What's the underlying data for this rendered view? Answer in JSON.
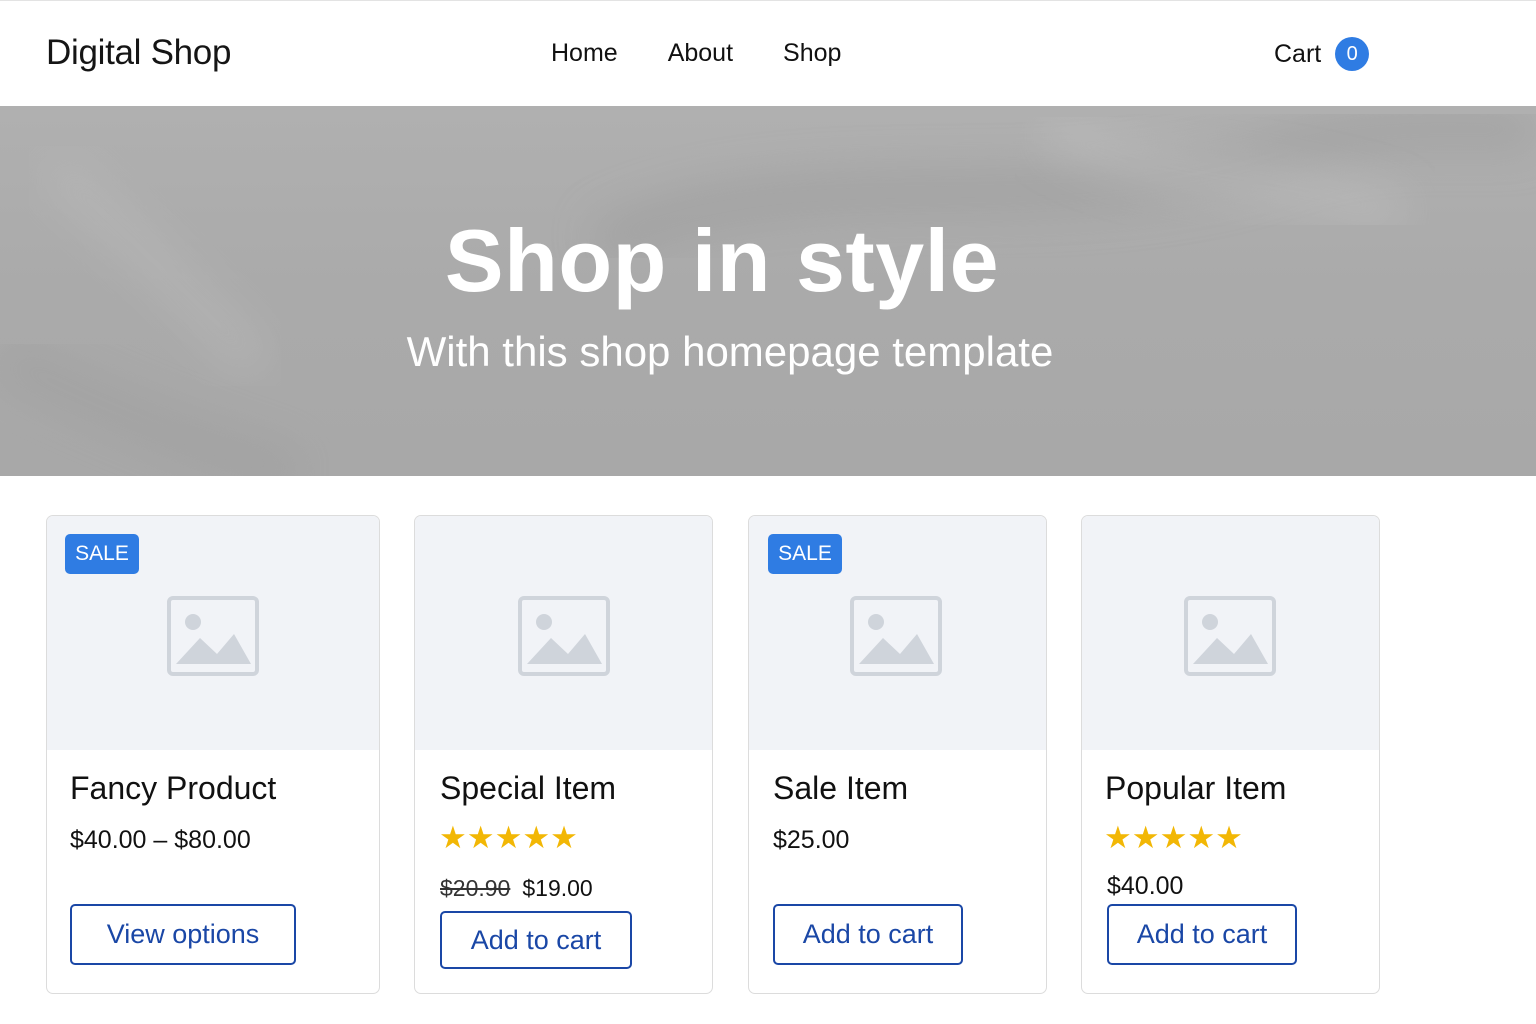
{
  "nav": {
    "brand": "Digital Shop",
    "links": [
      "Home",
      "About",
      "Shop"
    ],
    "cart_label": "Cart",
    "cart_count": "0"
  },
  "hero": {
    "title": "Shop in style",
    "subtitle": "With this shop homepage template"
  },
  "products": [
    {
      "badge": "SALE",
      "title": "Fancy Product",
      "price": "$40.00 – $80.00",
      "button": "View options",
      "image_icon": "image-placeholder-icon"
    },
    {
      "title": "Special Item",
      "rating": 5,
      "stars": "★★★★★",
      "old_price": "$20.90",
      "price": "$19.00",
      "button": "Add to cart",
      "image_icon": "image-placeholder-icon"
    },
    {
      "badge": "SALE",
      "title": "Sale Item",
      "price": "$25.00",
      "button": "Add to cart",
      "image_icon": "image-placeholder-icon"
    },
    {
      "title": "Popular Item",
      "rating": 5,
      "stars": "★★★★★",
      "price": "$40.00",
      "button": "Add to cart",
      "image_icon": "image-placeholder-icon"
    }
  ],
  "colors": {
    "accent": "#2f7ce3",
    "button_outline": "#1a47a6",
    "star": "#f2b705",
    "image_bg": "#f1f3f7"
  }
}
